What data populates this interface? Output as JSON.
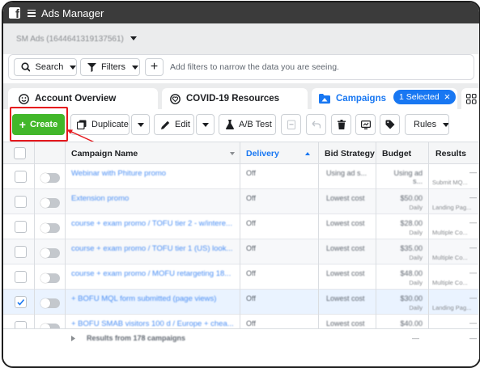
{
  "header": {
    "app_title": "Ads Manager",
    "logo_letter": "f"
  },
  "account": {
    "name": "SM Ads (1644641319137561)"
  },
  "filters": {
    "search_label": "Search",
    "filters_label": "Filters",
    "add_label": "+",
    "hint": "Add filters to narrow the data you are seeing."
  },
  "tabs": [
    {
      "label": "Account Overview",
      "icon": "smiley-icon"
    },
    {
      "label": "COVID-19 Resources",
      "icon": "heart-icon"
    },
    {
      "label": "Campaigns",
      "icon": "folder-icon"
    }
  ],
  "selected_pill": "1 Selected",
  "toolbar": {
    "create_label": "Create",
    "duplicate_label": "Duplicate",
    "edit_label": "Edit",
    "abtest_label": "A/B Test",
    "rules_label": "Rules"
  },
  "table": {
    "columns": [
      "Campaign Name",
      "Delivery",
      "Bid Strategy",
      "Budget",
      "Results"
    ],
    "rows": [
      {
        "name": "Webinar with Phiture promo",
        "delivery": "Off",
        "bid": "Using ad s...",
        "budget": "Using ad s...",
        "budget_sub": "",
        "result": "Submit MQ...",
        "selected": false
      },
      {
        "name": "Extension promo",
        "delivery": "Off",
        "bid": "Lowest cost",
        "budget": "$50.00",
        "budget_sub": "Daily",
        "result": "Landing Pag...",
        "selected": false
      },
      {
        "name": "course + exam promo / TOFU tier 2 - w/intere...",
        "delivery": "Off",
        "bid": "Lowest cost",
        "budget": "$28.00",
        "budget_sub": "Daily",
        "result": "Multiple Co...",
        "selected": false
      },
      {
        "name": "course + exam promo / TOFU tier 1 (US) look...",
        "delivery": "Off",
        "bid": "Lowest cost",
        "budget": "$35.00",
        "budget_sub": "Daily",
        "result": "Multiple Co...",
        "selected": false
      },
      {
        "name": "course + exam promo / MOFU retargeting 18...",
        "delivery": "Off",
        "bid": "Lowest cost",
        "budget": "$48.00",
        "budget_sub": "Daily",
        "result": "Multiple Co...",
        "selected": false
      },
      {
        "name": "+ BOFU MQL form submitted (page views)",
        "delivery": "Off",
        "bid": "Lowest cost",
        "budget": "$30.00",
        "budget_sub": "Daily",
        "result": "Landing Pag...",
        "selected": true
      },
      {
        "name": "+ BOFU SMAB visitors 100 d / Europe + chea...",
        "delivery": "Off",
        "bid": "Lowest cost",
        "budget": "$40.00",
        "budget_sub": "Daily",
        "result": "",
        "selected": false
      }
    ],
    "summary": "Results from 178 campaigns",
    "dash": "—"
  },
  "colors": {
    "accent": "#1877f2",
    "create_green": "#42b72a",
    "highlight_red": "#e5181d",
    "topbar": "#3b3b3b"
  }
}
